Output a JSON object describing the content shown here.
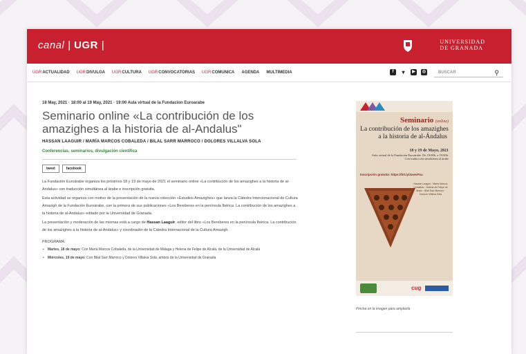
{
  "brand": {
    "canal": "canal",
    "ugr": "UGR"
  },
  "university": {
    "line1": "UNIVERSIDAD",
    "line2": "DE GRANADA"
  },
  "nav": {
    "items": [
      {
        "prefix": "UGR",
        "label": "ACTUALIDAD"
      },
      {
        "prefix": "UGR",
        "label": "DIVULGA"
      },
      {
        "prefix": "UGR",
        "label": "CULTURA"
      },
      {
        "prefix": "UGR",
        "label": "CONVOCATORIAS"
      },
      {
        "prefix": "UGR",
        "label": "COMUNICA"
      },
      {
        "prefix": "",
        "label": "AGENDA"
      },
      {
        "prefix": "",
        "label": "MULTIMEDIA"
      }
    ]
  },
  "search": {
    "placeholder": "BUSCAR"
  },
  "article": {
    "date": "18 May, 2021 · 18:00 al 19 May, 2021 · 19:00 Aula virtual de la Fundacion Euroarabe",
    "title": "Seminario online «La contribución de los amazighes a la historia de al-Andalus\"",
    "authors": "HASSAN LAAGUIR / MARÍA MARCOS COBALEDA / BILAL SARR MARROCO / DOLORES VILLALVA SOLA",
    "category": "Conferencias, seminarios, divulgación científica",
    "share_tweet": "tweet",
    "share_facebook": "facebook",
    "p1": "La Fundación Euroárabe organiza los próximos 18 y 19 de mayo de 2021 el seminario online «La contribución de los amazighes a la historia de al-Andalus» con traducción simultánea al árabe e inscripción gratuita.",
    "p2": "Esta actividad se organiza con motivo de la presentación de la nueva colección «Estudios Amazighes» que lanza la Cátedra Intercionacional de Cultura Amazigh de la Fundación Euroárabe, con la primera de sus publicaciones «Los Bereberes en la península Ibérica. La contribución de los amazighes a la historia de al-Andalus» editado por la Universidad de Granada.",
    "p3_a": "La presentación y moderación de las mismas está a cargo de ",
    "p3_b": "Hassan Laaguir",
    "p3_c": ", editor del libro «Los Bereberes en la península Ibérica. La contribución de los amazighes a la historia de al-Andalus» y coordinador de la Cátedra Internacional de la Cultura Amazigh.",
    "programa": "PROGRAMA:",
    "li1_a": "Martes, 18 de mayo:",
    "li1_b": " Con María Marcos Cobaleda, de la Universidad de Málaga y Helena de Felipe de Alcalá, de la Universidad de Alcalá",
    "li2_a": "Miércoles, 19 de mayo:",
    "li2_b": " Con Bilal Sarr Marroco y Dolores Villalva Sola, ambos de la Universidad de Granada"
  },
  "poster": {
    "seminario": "Seminario",
    "online": "(online)",
    "title1": "La contribución de los amazighes",
    "title2": "a la historia de al-Ándalus",
    "dates": "18 y 19 de Mayo, 2021",
    "place": "Aula virtual de la Fundación Euroárabe. De 18:00h. a 19:00h.",
    "translation": "Con traducción simultánea al árabe",
    "inscription": "Inscripción gratuita: https://bit.ly/3uwvPsu",
    "speakers": "Hassan Laaguir · María Marcos Cobaleda · Helena de Felipe de Jesús · Bilal Sarr Marroco · Dolores Villalva Sola",
    "caption": "Pincha en la imagen para ampliarla"
  },
  "colors": {
    "accent": "#c8202f",
    "category": "#2e8b2e"
  }
}
